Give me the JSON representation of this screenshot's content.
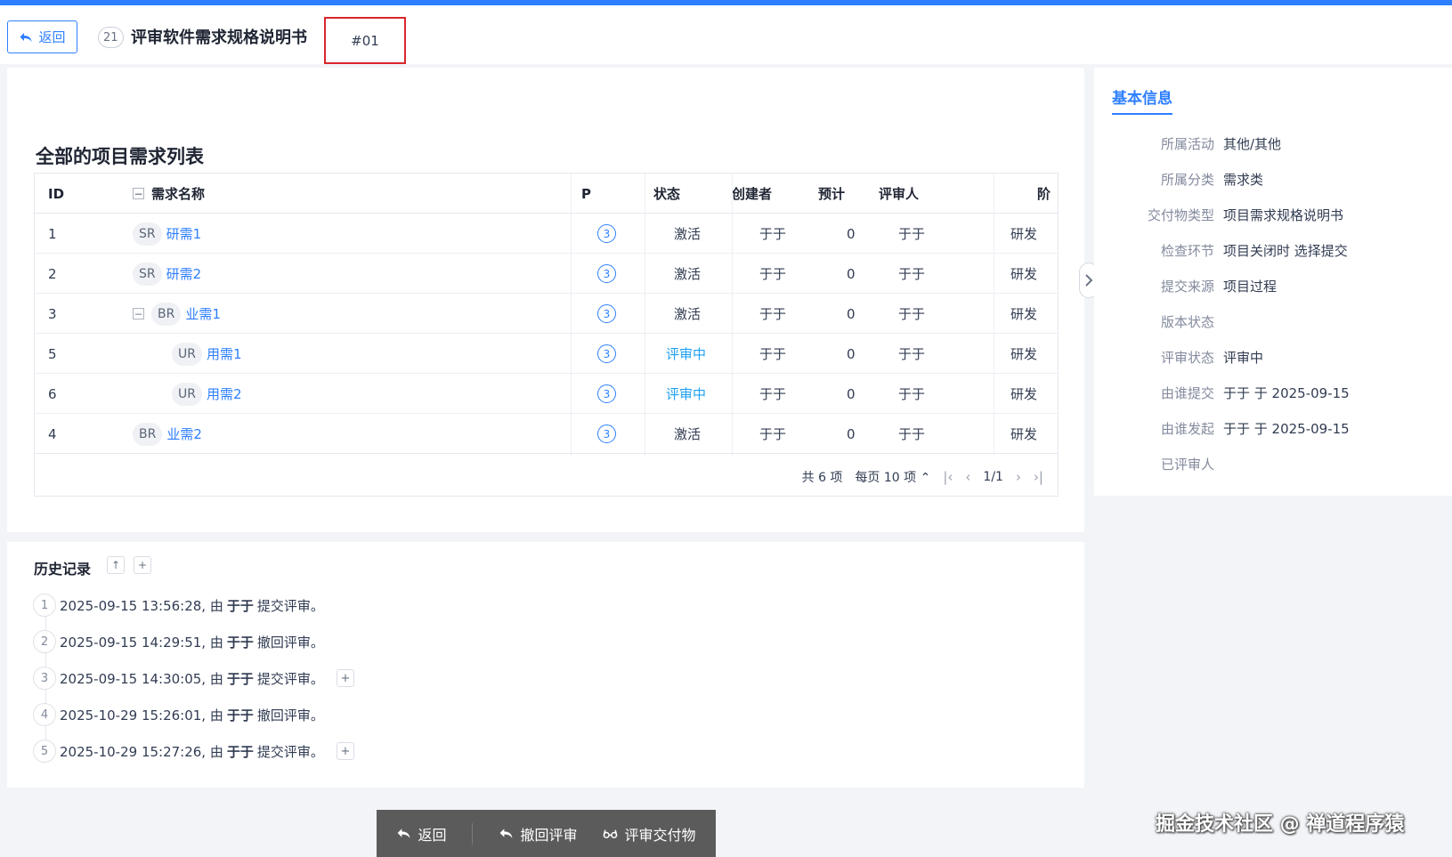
{
  "header": {
    "back_label": "返回",
    "id_badge": "21",
    "title": "评审软件需求规格说明书",
    "version": "#01"
  },
  "list": {
    "title": "全部的项目需求列表",
    "columns": {
      "id": "ID",
      "name": "需求名称",
      "pri": "P",
      "status": "状态",
      "creator": "创建者",
      "estimate": "预计",
      "reviewer": "评审人",
      "stage": "阶"
    },
    "rows": [
      {
        "id": "1",
        "tag": "SR",
        "name": "研需1",
        "pri": "3",
        "status": "激活",
        "creator": "于于",
        "estimate": "0",
        "reviewer": "于于",
        "stage": "研发"
      },
      {
        "id": "2",
        "tag": "SR",
        "name": "研需2",
        "pri": "3",
        "status": "激活",
        "creator": "于于",
        "estimate": "0",
        "reviewer": "于于",
        "stage": "研发"
      },
      {
        "id": "3",
        "tag": "BR",
        "name": "业需1",
        "pri": "3",
        "status": "激活",
        "creator": "于于",
        "estimate": "0",
        "reviewer": "于于",
        "stage": "研发"
      },
      {
        "id": "5",
        "tag": "UR",
        "name": "用需1",
        "pri": "3",
        "status": "评审中",
        "creator": "于于",
        "estimate": "0",
        "reviewer": "于于",
        "stage": "研发"
      },
      {
        "id": "6",
        "tag": "UR",
        "name": "用需2",
        "pri": "3",
        "status": "评审中",
        "creator": "于于",
        "estimate": "0",
        "reviewer": "于于",
        "stage": "研发"
      },
      {
        "id": "4",
        "tag": "BR",
        "name": "业需2",
        "pri": "3",
        "status": "激活",
        "creator": "于于",
        "estimate": "0",
        "reviewer": "于于",
        "stage": "研发"
      }
    ],
    "pager": {
      "total": "共 6 项",
      "per_page": "每页 10 项",
      "page": "1/1"
    }
  },
  "side": {
    "tab": "基本信息",
    "items": [
      {
        "label": "所属活动",
        "value": "其他/其他"
      },
      {
        "label": "所属分类",
        "value": "需求类"
      },
      {
        "label": "交付物类型",
        "value": "项目需求规格说明书"
      },
      {
        "label": "检查环节",
        "value": "项目关闭时 选择提交"
      },
      {
        "label": "提交来源",
        "value": "项目过程"
      },
      {
        "label": "版本状态",
        "value": ""
      },
      {
        "label": "评审状态",
        "value": "评审中"
      },
      {
        "label": "由谁提交",
        "value": "于于 于 2025-09-15"
      },
      {
        "label": "由谁发起",
        "value": "于于 于 2025-09-15"
      },
      {
        "label": "已评审人",
        "value": ""
      }
    ]
  },
  "history": {
    "title": "历史记录",
    "items": [
      {
        "num": "1",
        "time": "2025-09-15 13:56:28, 由",
        "user": "于于",
        "action": "提交评审。",
        "expand": false
      },
      {
        "num": "2",
        "time": "2025-09-15 14:29:51, 由",
        "user": "于于",
        "action": "撤回评审。",
        "expand": false
      },
      {
        "num": "3",
        "time": "2025-09-15 14:30:05, 由",
        "user": "于于",
        "action": "提交评审。",
        "expand": true
      },
      {
        "num": "4",
        "time": "2025-10-29 15:26:01, 由",
        "user": "于于",
        "action": "撤回评审。",
        "expand": false
      },
      {
        "num": "5",
        "time": "2025-10-29 15:27:26, 由",
        "user": "于于",
        "action": "提交评审。",
        "expand": true
      }
    ]
  },
  "actions": {
    "back": "返回",
    "withdraw": "撤回评审",
    "review": "评审交付物"
  },
  "watermark": "掘金技术社区 @ 禅道程序猿",
  "colors": {
    "primary": "#2e7fff",
    "reviewing": "#1da1f2",
    "highlight_box": "#d9262c",
    "action_bar": "#5b5b5b"
  }
}
